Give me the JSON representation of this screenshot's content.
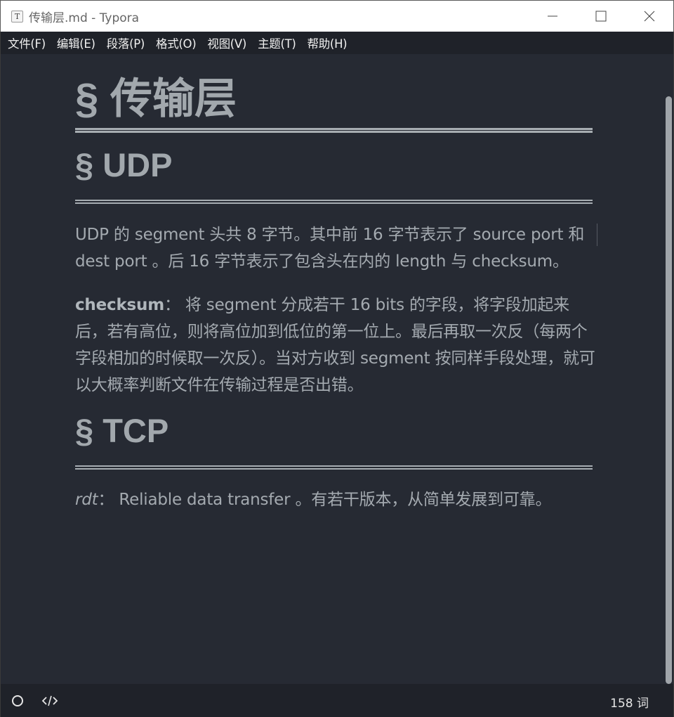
{
  "window": {
    "title": "传输层.md - Typora",
    "icon_letter": "T"
  },
  "menu": [
    {
      "label": "文件(F)"
    },
    {
      "label": "编辑(E)"
    },
    {
      "label": "段落(P)"
    },
    {
      "label": "格式(O)"
    },
    {
      "label": "视图(V)"
    },
    {
      "label": "主题(T)"
    },
    {
      "label": "帮助(H)"
    }
  ],
  "document": {
    "h1": "§ 传输层",
    "udp_heading": "§ UDP",
    "udp_para1": "UDP 的 segment 头共 8 字节。其中前 16 字节表示了 source port 和 dest port 。后 16 字节表示了包含头在内的 length 与 checksum。",
    "checksum_term": "checksum",
    "checksum_text": "： 将 segment 分成若干 16 bits 的字段，将字段加起来后，若有高位，则将高位加到低位的第一位上。最后再取一次反（每两个字段相加的时候取一次反）。当对方收到 segment 按同样手段处理，就可以大概率判断文件在传输过程是否出错。",
    "tcp_heading": "§ TCP",
    "rdt_term": "rdt",
    "rdt_text": "： Reliable data transfer 。有若干版本，从简单发展到可靠。"
  },
  "footer": {
    "word_count": "158 词",
    "left_icons": [
      "circle-outline-icon",
      "code-icon"
    ]
  },
  "colors": {
    "editor_bg": "#262a33",
    "menubar_bg": "#1f2229",
    "text": "#a4aab0",
    "rule": "#a7adb2"
  }
}
